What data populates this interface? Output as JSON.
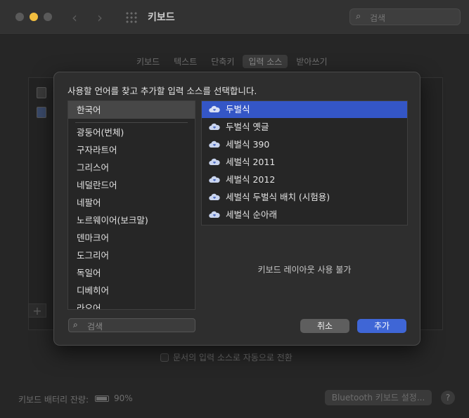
{
  "window": {
    "title": "키보드",
    "search_placeholder": "검색"
  },
  "background": {
    "tabs": [
      "키보드",
      "텍스트",
      "단축키",
      "입력 소스",
      "받아쓰기"
    ],
    "selected_tab": "입력 소스",
    "auto_switch_label": "문서의 입력 소스로 자동으로 전환",
    "battery_label": "키보드 배터리 잔량:",
    "battery_value": "90%",
    "bluetooth_button": "Bluetooth 키보드 설정...",
    "help_label": "?",
    "add_label": "+"
  },
  "dialog": {
    "prompt": "사용할 언어를 찾고 추가할 입력 소스를 선택합니다.",
    "languages": [
      "한국어",
      "광둥어(번체)",
      "구자라트어",
      "그리스어",
      "네덜란드어",
      "네팔어",
      "노르웨이어(보크말)",
      "덴마크어",
      "도그리어",
      "독일어",
      "디베히어",
      "라오어"
    ],
    "selected_language": "한국어",
    "input_sources": [
      "두벌식",
      "두벌식 옛글",
      "세벌식 390",
      "세벌식 2011",
      "세벌식 2012",
      "세벌식 두벌식 배치 (시험용)",
      "세벌식 순아래"
    ],
    "selected_source": "두벌식",
    "preview_message": "키보드 레이아웃 사용 불가",
    "search_placeholder": "검색",
    "cancel_label": "취소",
    "add_label": "추가"
  },
  "colors": {
    "accent": "#3f66d6",
    "selection": "#3456c6",
    "traffic_yellow": "#f2be3f"
  }
}
